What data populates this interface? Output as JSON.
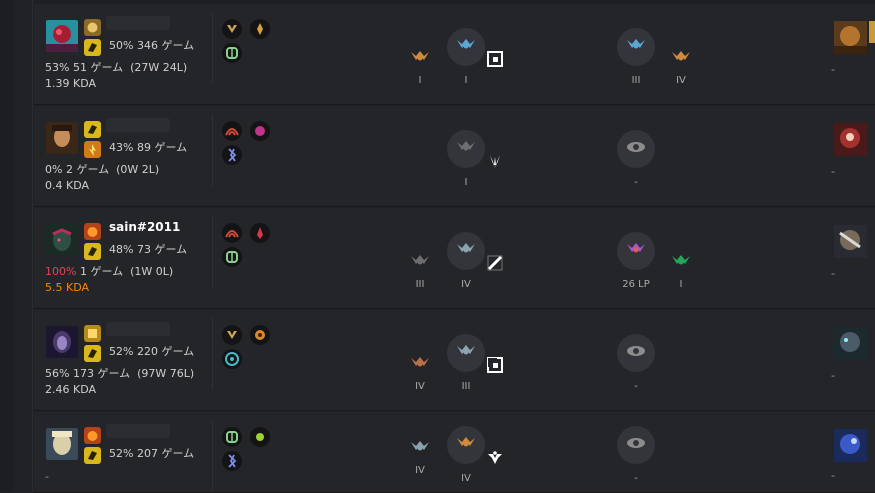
{
  "rows": [
    {
      "id": "r1",
      "name": "",
      "name_visible": false,
      "wr": "50% 346 ゲーム",
      "recent_pct": "53%",
      "recent_rest": " 51 ゲーム  (27W 24L)",
      "kda": "1.39 KDA",
      "kda_highlight": false,
      "emblems": [
        {
          "tier": "I",
          "color": "#cf8a3c"
        },
        {
          "tier": "I",
          "color": "#5ba7d4",
          "circle": true
        },
        {
          "tier": "III",
          "color": "#5ba7d4",
          "circle": true
        },
        {
          "tier": "IV",
          "color": "#cf8a3c"
        }
      ],
      "position_icon": "position-top-icon",
      "right_dash": "-"
    },
    {
      "id": "r2",
      "name": "",
      "name_visible": false,
      "wr": "43% 89 ゲーム",
      "recent_pct": "0%",
      "recent_rest": " 2 ゲーム  (0W 2L)",
      "kda": "0.4 KDA",
      "kda_highlight": false,
      "emblems": [
        {
          "tier": "I",
          "color": "#6e6e6e",
          "circle": true
        },
        {
          "tier": "-",
          "color": "#8c8c8c",
          "circle": true
        }
      ],
      "position_icon": "position-jungle-icon",
      "right_dash": "-"
    },
    {
      "id": "r3",
      "name": "sain#2011",
      "name_visible": true,
      "wr": "48% 73 ゲーム",
      "recent_pct": "100%",
      "recent_rest": " 1 ゲーム  (1W 0L)",
      "kda": "5.5 KDA",
      "kda_highlight": true,
      "emblems": [
        {
          "tier": "III",
          "color": "#6e6e6e"
        },
        {
          "tier": "IV",
          "color": "#8aa4b0",
          "circle": true
        },
        {
          "tier": "26 LP",
          "color": "#a956c9",
          "circle": true
        },
        {
          "tier": "I",
          "color": "#22a85a"
        }
      ],
      "position_icon": "position-mid-icon",
      "right_dash": "-"
    },
    {
      "id": "r4",
      "name": "",
      "name_visible": false,
      "wr": "52% 220 ゲーム",
      "recent_pct": "56%",
      "recent_rest": " 173 ゲーム  (97W 76L)",
      "kda": "2.46 KDA",
      "kda_highlight": false,
      "emblems": [
        {
          "tier": "IV",
          "color": "#b8704a"
        },
        {
          "tier": "III",
          "color": "#8aa4b0",
          "circle": true
        },
        {
          "tier": "-",
          "color": "#8c8c8c",
          "circle": true
        }
      ],
      "position_icon": "position-bot-icon",
      "right_dash": "-"
    },
    {
      "id": "r5",
      "name": "",
      "name_visible": false,
      "wr": "52% 207 ゲーム",
      "dash": "-",
      "emblems": [
        {
          "tier": "IV",
          "color": "#8aa4b0"
        },
        {
          "tier": "IV",
          "color": "#cf8a3c",
          "circle": true
        },
        {
          "tier": "-",
          "color": "#8c8c8c",
          "circle": true
        }
      ],
      "position_icon": "position-support-icon",
      "right_dash": "-"
    }
  ]
}
